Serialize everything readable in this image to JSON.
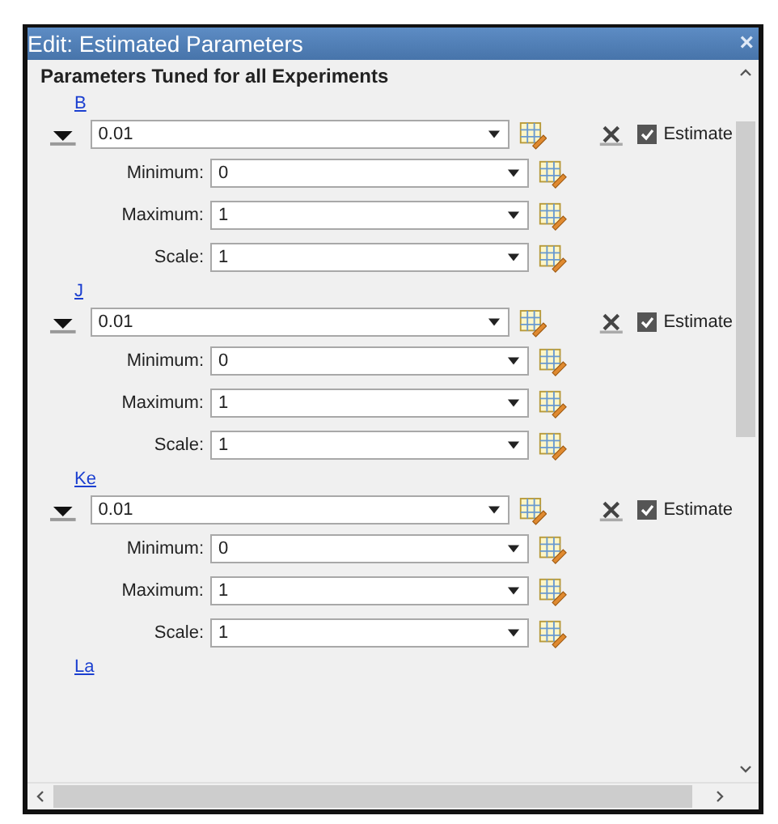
{
  "window": {
    "title": "Edit: Estimated Parameters",
    "close": "×"
  },
  "section": {
    "title": "Parameters Tuned for all Experiments"
  },
  "parameters": [
    {
      "name": "B",
      "value": "0.01",
      "estimate": {
        "label": "Estimate",
        "checked": true
      },
      "fields": [
        {
          "label": "Minimum:",
          "value": "0"
        },
        {
          "label": "Maximum:",
          "value": "1"
        },
        {
          "label": "Scale:",
          "value": "1"
        }
      ]
    },
    {
      "name": "J",
      "value": "0.01",
      "estimate": {
        "label": "Estimate",
        "checked": true
      },
      "fields": [
        {
          "label": "Minimum:",
          "value": "0"
        },
        {
          "label": "Maximum:",
          "value": "1"
        },
        {
          "label": "Scale:",
          "value": "1"
        }
      ]
    },
    {
      "name": "Ke",
      "value": "0.01",
      "estimate": {
        "label": "Estimate",
        "checked": true
      },
      "fields": [
        {
          "label": "Minimum:",
          "value": "0"
        },
        {
          "label": "Maximum:",
          "value": "1"
        },
        {
          "label": "Scale:",
          "value": "1"
        }
      ]
    },
    {
      "name": "La"
    }
  ]
}
